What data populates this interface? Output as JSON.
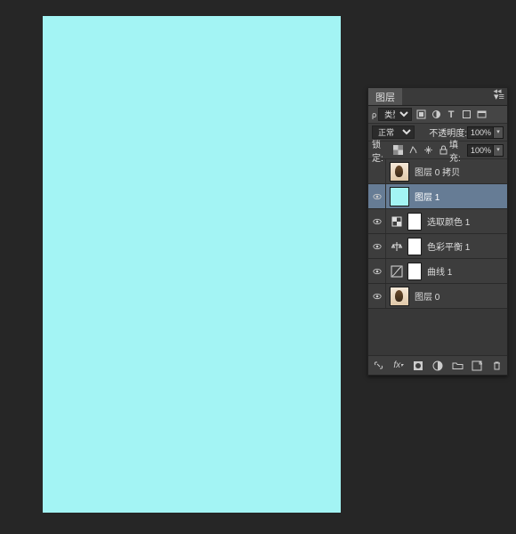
{
  "panel": {
    "title": "图层",
    "filter_label": "类型",
    "blend_mode": "正常",
    "opacity_label": "不透明度:",
    "opacity_value": "100%",
    "lock_label": "锁定:",
    "fill_label": "填充:",
    "fill_value": "100%"
  },
  "layers": [
    {
      "name": "图层 0 拷贝",
      "visible": false,
      "selected": false,
      "thumb": "photo"
    },
    {
      "name": "图层 1",
      "visible": true,
      "selected": true,
      "thumb": "fill"
    },
    {
      "name": "选取颜色 1",
      "visible": true,
      "selected": false,
      "thumb": "adj",
      "icon": "selcolor"
    },
    {
      "name": "色彩平衡 1",
      "visible": true,
      "selected": false,
      "thumb": "adj",
      "icon": "balance"
    },
    {
      "name": "曲线 1",
      "visible": true,
      "selected": false,
      "thumb": "adj",
      "icon": "curves"
    },
    {
      "name": "图层 0",
      "visible": true,
      "selected": false,
      "thumb": "photo"
    }
  ],
  "colors": {
    "canvas": "#a3f4f4"
  }
}
